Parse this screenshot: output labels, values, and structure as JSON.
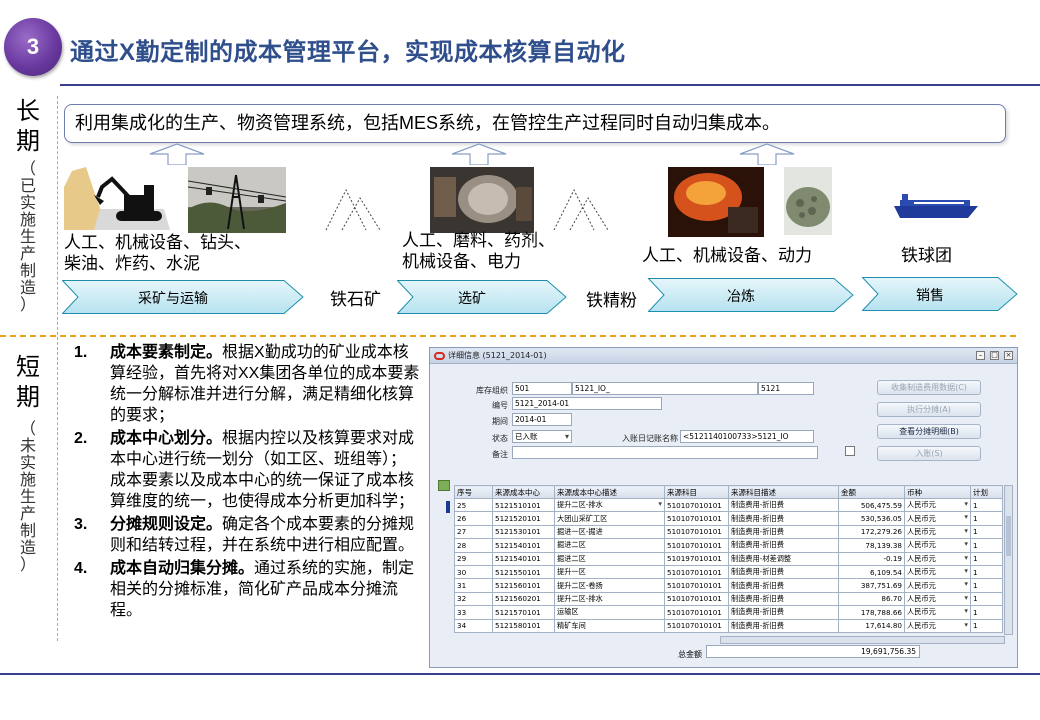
{
  "header": {
    "number": "3",
    "title": "通过X勤定制的成本管理平台，实现成本核算自动化"
  },
  "left_labels": {
    "long": {
      "main": [
        "长",
        "期"
      ],
      "sub": [
        "（",
        "已",
        "实",
        "施",
        "生",
        "产",
        "制",
        "造",
        "）"
      ]
    },
    "short": {
      "main": [
        "短",
        "期"
      ],
      "sub": [
        "（",
        "未",
        "实",
        "施",
        "生",
        "产",
        "制",
        "造",
        "）"
      ]
    }
  },
  "long_term": {
    "intro": "利用集成化的生产、物资管理系统，包括MES系统，在管控生产过程同时自动归集成本。",
    "stage_texts": [
      [
        "人工、机械设备、钻头、",
        "柴油、炸药、水泥"
      ],
      [
        "人工、磨料、药剂、",
        "机械设备、电力"
      ],
      [
        "人工、机械设备、动力"
      ],
      [
        "铁球团"
      ]
    ],
    "products": [
      "铁石矿",
      "铁精粉"
    ],
    "process_chevrons": [
      "采矿与运输",
      "选矿",
      "冶炼",
      "销售"
    ]
  },
  "short_term": {
    "steps": [
      {
        "no": "1.",
        "title": "成本要素制定。",
        "text": "根据X勤成功的矿业成本核算经验，首先将对XX集团各单位的成本要素统一分解标准并进行分解，满足精细化核算的要求；"
      },
      {
        "no": "2.",
        "title": "成本中心划分。",
        "text": "根据内控以及核算要求对成本中心进行统一划分（如工区、班组等）；成本要素以及成本中心的统一保证了成本核算维度的统一，也使得成本分析更加科学；"
      },
      {
        "no": "3.",
        "title": "分摊规则设定。",
        "text": "确定各个成本要素的分摊规则和结转过程，并在系统中进行相应配置。"
      },
      {
        "no": "4.",
        "title": "成本自动归集分摊。",
        "text": "通过系统的实施，制定相关的分摊标准，简化矿产品成本分摊流程。"
      }
    ]
  },
  "erp_window": {
    "title": "详细信息 (5121_2014-01)",
    "fields": {
      "org_label": "库存组织",
      "org_code": "501",
      "org_name": "5121_IO_",
      "org_ext": "5121",
      "code_label": "编号",
      "code_value": "5121_2014-01",
      "period_label": "期间",
      "period_value": "2014-01",
      "status_label": "状态",
      "status_value": "已入账",
      "journal_label": "入账日记账名称",
      "journal_value": "<5121140100733>5121_IO",
      "note_label": "备注"
    },
    "buttons": [
      {
        "label": "收集制造费用数据(C)",
        "enabled": false
      },
      {
        "label": "执行分摊(A)",
        "enabled": false
      },
      {
        "label": "查看分摊明细(B)",
        "enabled": true
      },
      {
        "label": "入账(S)",
        "enabled": false
      }
    ],
    "checkbox_label": "[ ]",
    "columns": [
      "序号",
      "来源成本中心",
      "来源成本中心描述",
      "来源科目",
      "来源科目描述",
      "金额",
      "币种",
      "计划"
    ],
    "rows": [
      [
        "25",
        "5121510101",
        "提升二区-排水",
        "510107010101",
        "制造费用-折旧费",
        "506,475.59",
        "人民币元",
        "1"
      ],
      [
        "26",
        "5121520101",
        "大团山采矿工区",
        "510107010101",
        "制造费用-折旧费",
        "530,536.05",
        "人民币元",
        "1"
      ],
      [
        "27",
        "5121530101",
        "掘进一区-掘进",
        "510107010101",
        "制造费用-折旧费",
        "172,279.26",
        "人民币元",
        "1"
      ],
      [
        "28",
        "5121540101",
        "掘进二区",
        "510107010101",
        "制造费用-折旧费",
        "78,139.38",
        "人民币元",
        "1"
      ],
      [
        "29",
        "5121540101",
        "掘进二区",
        "510197010101",
        "制造费用-材差调整",
        "-0.19",
        "人民币元",
        "1"
      ],
      [
        "30",
        "5121550101",
        "提升一区",
        "510107010101",
        "制造费用-折旧费",
        "6,109.54",
        "人民币元",
        "1"
      ],
      [
        "31",
        "5121560101",
        "提升二区-卷扬",
        "510107010101",
        "制造费用-折旧费",
        "387,751.69",
        "人民币元",
        "1"
      ],
      [
        "32",
        "5121560201",
        "提升二区-排水",
        "510107010101",
        "制造费用-折旧费",
        "86.70",
        "人民币元",
        "1"
      ],
      [
        "33",
        "5121570101",
        "运输区",
        "510107010101",
        "制造费用-折旧费",
        "178,788.66",
        "人民币元",
        "1"
      ],
      [
        "34",
        "5121580101",
        "精矿车间",
        "510107010101",
        "制造费用-折旧费",
        "17,614.80",
        "人民币元",
        "1"
      ]
    ],
    "total_label": "总金额",
    "total_value": "19,691,756.35"
  }
}
